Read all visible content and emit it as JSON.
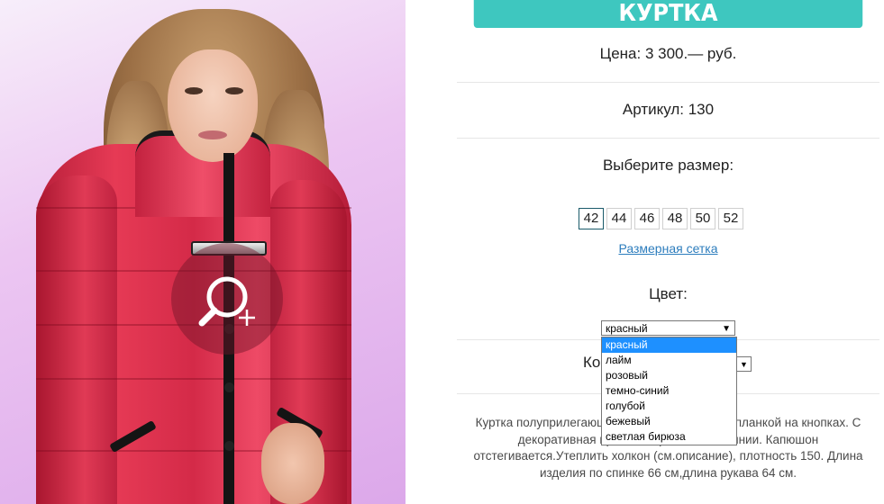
{
  "product": {
    "title": "КУРТКА",
    "price": "Цена: 3 300.— руб.",
    "article": "Артикул: 130",
    "size_prompt": "Выберите размер:",
    "sizes": [
      "42",
      "44",
      "46",
      "48",
      "50",
      "52"
    ],
    "selected_size": "42",
    "size_chart_link": "Размерная сетка",
    "color_label": "Цвет:",
    "color_selected": "красный",
    "color_options": [
      "красный",
      "лайм",
      "розовый",
      "темно-синий",
      "голубой",
      "бежевый",
      "светлая бирюза"
    ],
    "quantity_label_partial": "Ко",
    "description": "Куртка полуприлегающ                                  крытой декоративной планкой на кнопках. С                                  декоративная пряжка, карманы на молнии. Капюшон отстегивается.Утеплить холкон (см.описание), плотность 150. Длина изделия по спинке 66 см,длина рукава 64 см."
  },
  "colors": {
    "title_bar": "#3ec7bf",
    "link": "#2d7dbd",
    "dropdown_highlight": "#1e90ff",
    "jacket": "#e03a55"
  },
  "icons": {
    "zoom": "magnifier-plus-icon",
    "select_arrow": "triangle-down-icon"
  }
}
